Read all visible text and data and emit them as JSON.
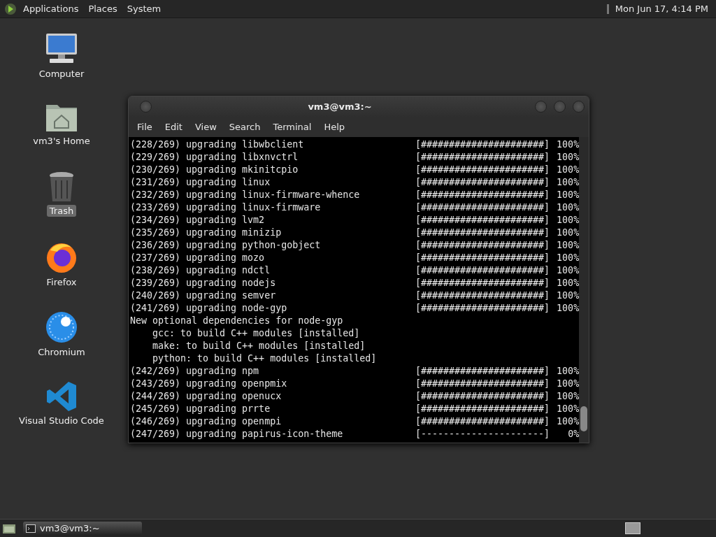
{
  "top_panel": {
    "menus": [
      "Applications",
      "Places",
      "System"
    ],
    "clock": "Mon Jun 17,  4:14 PM"
  },
  "desktop_icons": [
    {
      "kind": "computer",
      "label": "Computer",
      "selected": false
    },
    {
      "kind": "home",
      "label": "vm3's Home",
      "selected": false
    },
    {
      "kind": "trash",
      "label": "Trash",
      "selected": true
    },
    {
      "kind": "firefox",
      "label": "Firefox",
      "selected": false
    },
    {
      "kind": "chromium",
      "label": "Chromium",
      "selected": false
    },
    {
      "kind": "vscode",
      "label": "Visual Studio Code",
      "selected": false
    }
  ],
  "terminal": {
    "title": "vm3@vm3:~",
    "menu": [
      "File",
      "Edit",
      "View",
      "Search",
      "Terminal",
      "Help"
    ],
    "lines": [
      {
        "kind": "progress",
        "text": "(228/269) upgrading libwbclient",
        "bar": "[######################]",
        "percent": "100%"
      },
      {
        "kind": "progress",
        "text": "(229/269) upgrading libxnvctrl",
        "bar": "[######################]",
        "percent": "100%"
      },
      {
        "kind": "progress",
        "text": "(230/269) upgrading mkinitcpio",
        "bar": "[######################]",
        "percent": "100%"
      },
      {
        "kind": "progress",
        "text": "(231/269) upgrading linux",
        "bar": "[######################]",
        "percent": "100%"
      },
      {
        "kind": "progress",
        "text": "(232/269) upgrading linux-firmware-whence",
        "bar": "[######################]",
        "percent": "100%"
      },
      {
        "kind": "progress",
        "text": "(233/269) upgrading linux-firmware",
        "bar": "[######################]",
        "percent": "100%"
      },
      {
        "kind": "progress",
        "text": "(234/269) upgrading lvm2",
        "bar": "[######################]",
        "percent": "100%"
      },
      {
        "kind": "progress",
        "text": "(235/269) upgrading minizip",
        "bar": "[######################]",
        "percent": "100%"
      },
      {
        "kind": "progress",
        "text": "(236/269) upgrading python-gobject",
        "bar": "[######################]",
        "percent": "100%"
      },
      {
        "kind": "progress",
        "text": "(237/269) upgrading mozo",
        "bar": "[######################]",
        "percent": "100%"
      },
      {
        "kind": "progress",
        "text": "(238/269) upgrading ndctl",
        "bar": "[######################]",
        "percent": "100%"
      },
      {
        "kind": "progress",
        "text": "(239/269) upgrading nodejs",
        "bar": "[######################]",
        "percent": "100%"
      },
      {
        "kind": "progress",
        "text": "(240/269) upgrading semver",
        "bar": "[######################]",
        "percent": "100%"
      },
      {
        "kind": "progress",
        "text": "(241/269) upgrading node-gyp",
        "bar": "[######################]",
        "percent": "100%"
      },
      {
        "kind": "text",
        "text": "New optional dependencies for node-gyp"
      },
      {
        "kind": "text",
        "text": "    gcc: to build C++ modules [installed]"
      },
      {
        "kind": "text",
        "text": "    make: to build C++ modules [installed]"
      },
      {
        "kind": "text",
        "text": "    python: to build C++ modules [installed]"
      },
      {
        "kind": "progress",
        "text": "(242/269) upgrading npm",
        "bar": "[######################]",
        "percent": "100%"
      },
      {
        "kind": "progress",
        "text": "(243/269) upgrading openpmix",
        "bar": "[######################]",
        "percent": "100%"
      },
      {
        "kind": "progress",
        "text": "(244/269) upgrading openucx",
        "bar": "[######################]",
        "percent": "100%"
      },
      {
        "kind": "progress",
        "text": "(245/269) upgrading prrte",
        "bar": "[######################]",
        "percent": "100%"
      },
      {
        "kind": "progress",
        "text": "(246/269) upgrading openmpi",
        "bar": "[######################]",
        "percent": "100%"
      },
      {
        "kind": "progress",
        "text": "(247/269) upgrading papirus-icon-theme",
        "bar": "[----------------------]",
        "percent": "0%"
      }
    ]
  },
  "taskbar": {
    "tasks": [
      {
        "label": "vm3@vm3:~",
        "selected": true
      }
    ]
  }
}
